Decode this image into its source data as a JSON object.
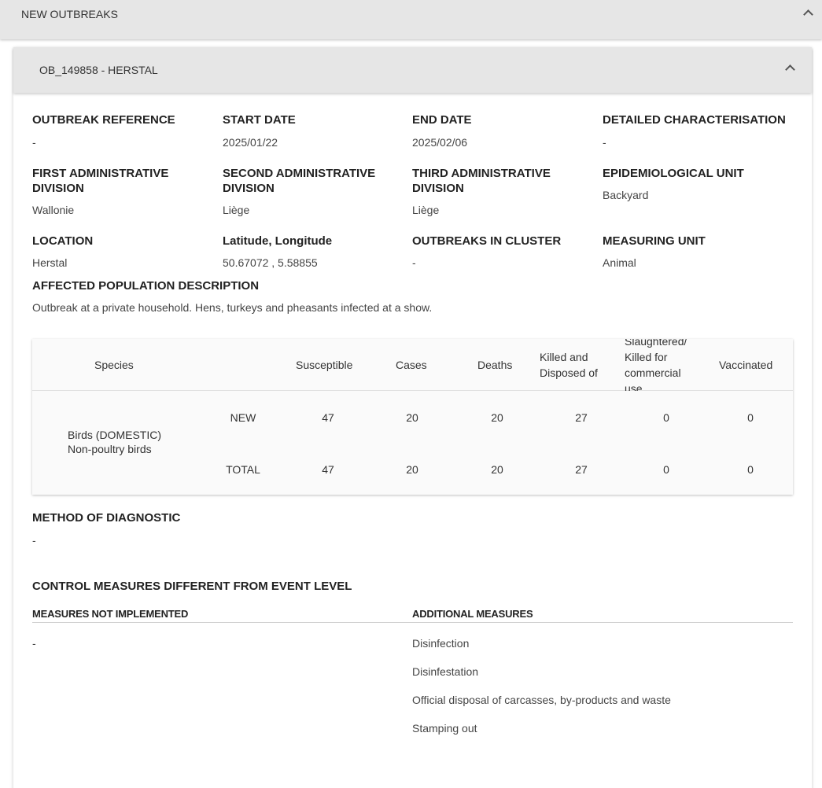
{
  "section": {
    "title": "NEW OUTBREAKS"
  },
  "card": {
    "title": "OB_149858 - HERSTAL"
  },
  "fields": {
    "outbreak_reference": {
      "label": "OUTBREAK REFERENCE",
      "value": "-"
    },
    "start_date": {
      "label": "START DATE",
      "value": "2025/01/22"
    },
    "end_date": {
      "label": "END DATE",
      "value": "2025/02/06"
    },
    "detailed_characterisation": {
      "label": "DETAILED CHARACTERISATION",
      "value": "-"
    },
    "first_admin": {
      "label_line1": "FIRST ADMINISTRATIVE",
      "label_line2": "DIVISION",
      "value": "Wallonie"
    },
    "second_admin": {
      "label_line1": "SECOND ADMINISTRATIVE",
      "label_line2": "DIVISION",
      "value": "Liège"
    },
    "third_admin": {
      "label_line1": "THIRD ADMINISTRATIVE",
      "label_line2": "DIVISION",
      "value": "Liège"
    },
    "epi_unit": {
      "label": "EPIDEMIOLOGICAL UNIT",
      "value": "Backyard"
    },
    "location": {
      "label": "LOCATION",
      "value": "Herstal"
    },
    "lat_long": {
      "label": "Latitude, Longitude",
      "value": "50.67072 , 5.58855"
    },
    "outbreaks_in_cluster": {
      "label": "OUTBREAKS IN CLUSTER",
      "value": "-"
    },
    "measuring_unit": {
      "label": "MEASURING UNIT",
      "value": "Animal"
    }
  },
  "affected_population": {
    "label": "AFFECTED POPULATION DESCRIPTION",
    "value": "Outbreak at a private household. Hens, turkeys and pheasants infected at a show."
  },
  "table": {
    "headers": {
      "species": "Species",
      "susceptible": "Susceptible",
      "cases": "Cases",
      "deaths": "Deaths",
      "killed_line1": "Killed and",
      "killed_line2": "Disposed of",
      "slaughtered_line1": "Slaughtered/",
      "slaughtered_line2": "Killed for",
      "slaughtered_line3": "commercial",
      "slaughtered_line4": "use",
      "vaccinated": "Vaccinated"
    },
    "species_line1": "Birds (DOMESTIC)",
    "species_line2": "Non-poultry birds",
    "rows": [
      {
        "label": "NEW",
        "susceptible": "47",
        "cases": "20",
        "deaths": "20",
        "killed": "27",
        "slaughtered": "0",
        "vaccinated": "0"
      },
      {
        "label": "TOTAL",
        "susceptible": "47",
        "cases": "20",
        "deaths": "20",
        "killed": "27",
        "slaughtered": "0",
        "vaccinated": "0"
      }
    ]
  },
  "diagnostic": {
    "label": "METHOD OF DIAGNOSTIC",
    "value": "-"
  },
  "control_measures": {
    "title": "CONTROL MEASURES DIFFERENT FROM EVENT LEVEL",
    "not_implemented_label": "MEASURES NOT IMPLEMENTED",
    "not_implemented_value": "-",
    "additional_label": "ADDITIONAL MEASURES",
    "additional": [
      "Disinfection",
      "Disinfestation",
      "Official disposal of carcasses, by-products and waste",
      "Stamping out"
    ]
  }
}
